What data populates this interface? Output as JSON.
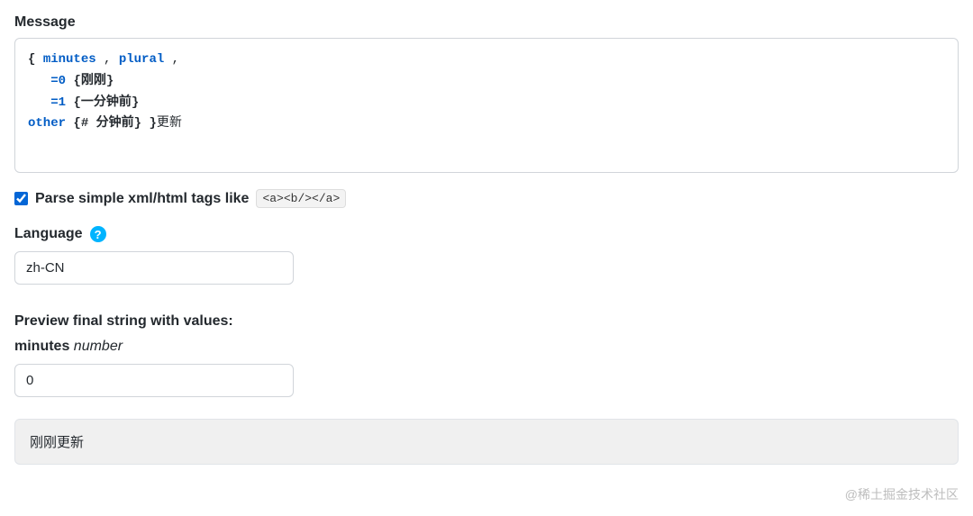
{
  "message": {
    "label": "Message",
    "code": {
      "line1_open": "{",
      "line1_var": "minutes",
      "line1_comma1": " , ",
      "line1_key": "plural",
      "line1_comma2": " ,",
      "line2_indent": "   ",
      "line2_case": "=0",
      "line2_sp": " ",
      "line2_open": "{",
      "line2_text": "刚刚",
      "line2_close": "}",
      "line3_indent": "   ",
      "line3_case": "=1",
      "line3_sp": " ",
      "line3_open": "{",
      "line3_text": "一分钟前",
      "line3_close": "}",
      "line4_key": "other",
      "line4_sp": " ",
      "line4_open": "{",
      "line4_hash": "#",
      "line4_text": " 分钟前",
      "line4_close": "}",
      "line4_sp2": " ",
      "line4_outer_close": "}",
      "line4_tail": "更新"
    }
  },
  "parse": {
    "checked": true,
    "label": "Parse simple xml/html tags like",
    "example": "<a><b/></a>"
  },
  "language": {
    "label": "Language",
    "value": "zh-CN"
  },
  "preview": {
    "label": "Preview final string with values:",
    "var_name": "minutes",
    "var_type": "number",
    "var_value": "0",
    "output": "刚刚更新"
  },
  "watermark": "@稀土掘金技术社区"
}
